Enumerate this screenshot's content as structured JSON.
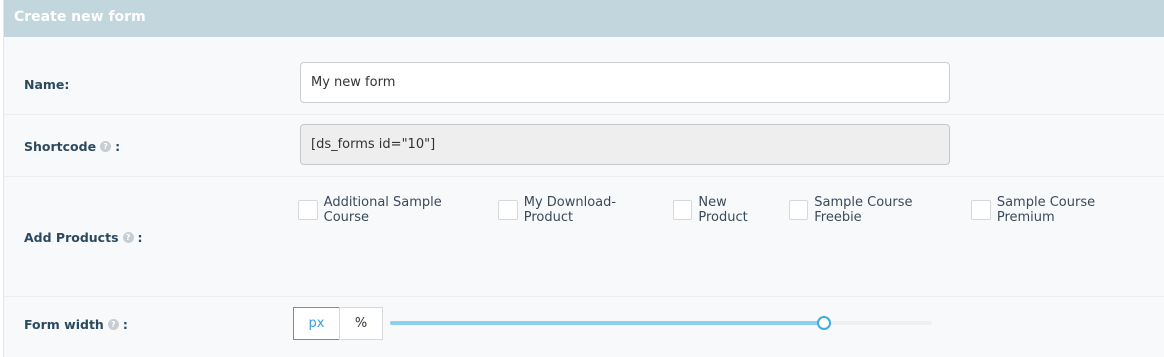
{
  "panel": {
    "title": "Create new form"
  },
  "fields": {
    "name": {
      "label": "Name:",
      "value": "My new form"
    },
    "shortcode": {
      "label": "Shortcode",
      "colon": ":",
      "value": "[ds_forms id=\"10\"]"
    },
    "products": {
      "label": "Add Products",
      "colon": ":",
      "items": [
        {
          "label": "Additional Sample Course",
          "checked": false
        },
        {
          "label": "My Download-Product",
          "checked": false
        },
        {
          "label": "New Product",
          "checked": false
        },
        {
          "label": "Sample Course Freebie",
          "checked": false
        },
        {
          "label": "Sample Course Premium",
          "checked": false
        }
      ]
    },
    "form_width": {
      "label": "Form width",
      "colon": ":",
      "units": [
        "px",
        "%"
      ],
      "selected_unit": "px",
      "slider_level": 0.8
    }
  },
  "icons": {
    "help": "help-icon"
  },
  "colors": {
    "header": "#c2d6dd",
    "accent": "#3b9fe0",
    "slider_fill": "#8ccfee"
  }
}
